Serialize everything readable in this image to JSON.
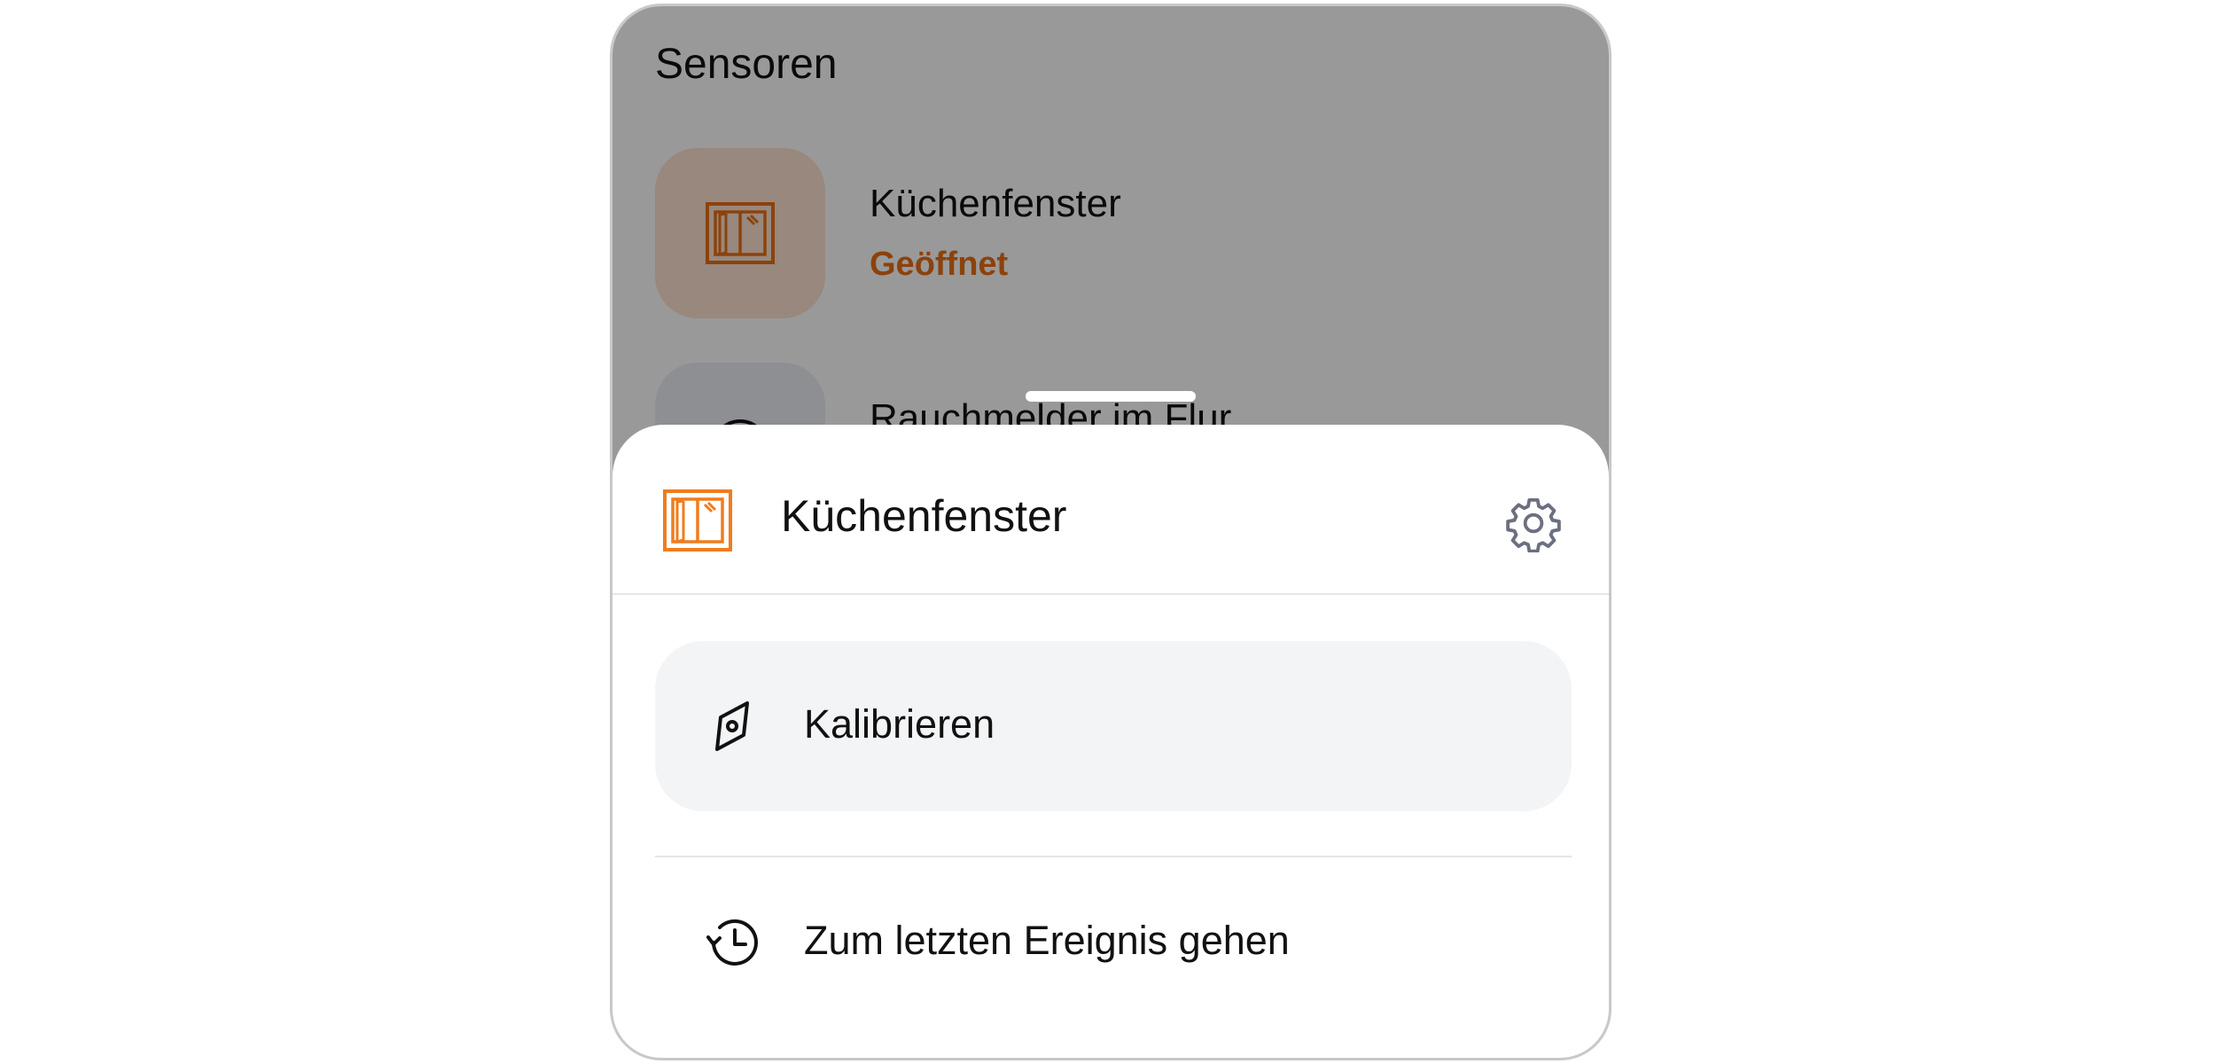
{
  "screen": {
    "title": "Sensoren"
  },
  "sensors": [
    {
      "name": "Küchenfenster",
      "status": "Geöffnet",
      "icon": "window-icon",
      "status_color": "#ea6f14"
    },
    {
      "name": "Rauchmelder im Flur",
      "icon": "smoke-detector-icon"
    }
  ],
  "sheet": {
    "title": "Küchenfenster",
    "icon": "window-icon",
    "settings_icon": "gear-icon",
    "actions": [
      {
        "label": "Kalibrieren",
        "icon": "compass-icon"
      },
      {
        "label": "Zum letzten Ereignis gehen",
        "icon": "history-icon"
      }
    ]
  },
  "colors": {
    "accent": "#f07c1e",
    "overlay": "rgba(0,0,0,0.40)",
    "action_bg": "#f3f4f6",
    "gear": "#6b6f80"
  }
}
